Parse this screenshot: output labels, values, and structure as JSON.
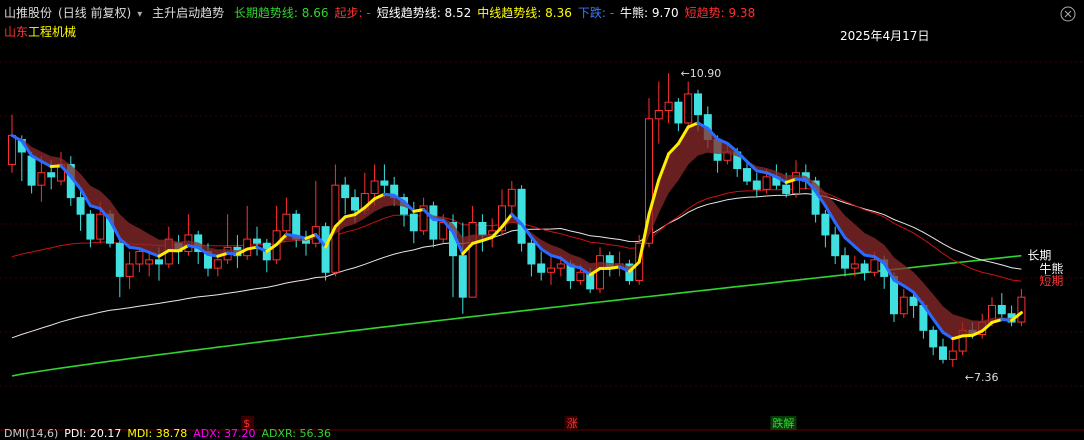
{
  "header": {
    "stock_name": "山推股份",
    "period": "(日线 前复权)",
    "dropdown_icon": "chevron-down-icon",
    "indicator_name": "主升启动趋势",
    "items": [
      {
        "label": "长期趋势线:",
        "value": "8.66",
        "color": "#2fd62f"
      },
      {
        "label": "起步:",
        "value": "-",
        "color": "#ff3030"
      },
      {
        "label": "短线趋势线:",
        "value": "8.52",
        "color": "#ffffff"
      },
      {
        "label": "中线趋势线:",
        "value": "8.36",
        "color": "#ffff00"
      },
      {
        "label": "下跌:",
        "value": "-",
        "color": "#3a7bff"
      },
      {
        "label": "牛熊:",
        "value": "9.70",
        "color": "#ffffff"
      },
      {
        "label": "短趋势:",
        "value": "9.38",
        "color": "#ff3030"
      }
    ],
    "close_icon": "close-circle-icon"
  },
  "subtitle": {
    "region": "山东",
    "sector": "工程机械"
  },
  "footer": {
    "items": [
      {
        "label": "DMI(14,6)",
        "value": "",
        "color": "#cccccc"
      },
      {
        "label": "PDI:",
        "value": "20.17",
        "color": "#ffffff"
      },
      {
        "label": "MDI:",
        "value": "38.78",
        "color": "#ffff00"
      },
      {
        "label": "ADX:",
        "value": "37.20",
        "color": "#ff00ff"
      },
      {
        "label": "ADXR:",
        "value": "56.36",
        "color": "#2fd62f"
      }
    ]
  },
  "chart_data": {
    "type": "candlestick",
    "ylim": [
      6.9,
      11.3
    ],
    "date_label": "2025年4月17日",
    "price_high": "10.90",
    "price_low": "7.36",
    "line_labels": {
      "bull_bear": "牛熊",
      "short_term": "短期",
      "long_term": "长期"
    },
    "signals": [
      {
        "index": 24,
        "text": "$",
        "color": "#ff3030"
      },
      {
        "index": 57,
        "text": "涨",
        "color": "#ff3030"
      },
      {
        "index": 78,
        "text": "跌解",
        "color": "#2fd62f"
      }
    ],
    "candles": [
      [
        9.8,
        10.15,
        10.4,
        9.7
      ],
      [
        10.1,
        9.95,
        10.15,
        9.6
      ],
      [
        9.9,
        9.55,
        9.95,
        9.45
      ],
      [
        9.55,
        9.7,
        9.9,
        9.35
      ],
      [
        9.7,
        9.65,
        9.85,
        9.5
      ],
      [
        9.6,
        9.8,
        9.95,
        9.55
      ],
      [
        9.8,
        9.4,
        9.9,
        9.3
      ],
      [
        9.4,
        9.2,
        9.5,
        9.0
      ],
      [
        9.2,
        8.9,
        9.25,
        8.8
      ],
      [
        8.9,
        9.2,
        9.35,
        8.85
      ],
      [
        9.2,
        8.85,
        9.25,
        8.8
      ],
      [
        8.85,
        8.45,
        8.9,
        8.2
      ],
      [
        8.45,
        8.6,
        8.75,
        8.3
      ],
      [
        8.6,
        8.75,
        8.8,
        8.5
      ],
      [
        8.6,
        8.65,
        8.75,
        8.45
      ],
      [
        8.65,
        8.6,
        8.8,
        8.4
      ],
      [
        8.6,
        8.9,
        9.05,
        8.55
      ],
      [
        8.85,
        8.75,
        8.95,
        8.6
      ],
      [
        8.75,
        8.95,
        9.2,
        8.7
      ],
      [
        8.95,
        8.75,
        9.0,
        8.6
      ],
      [
        8.75,
        8.55,
        8.85,
        8.45
      ],
      [
        8.55,
        8.65,
        8.7,
        8.45
      ],
      [
        8.65,
        8.8,
        9.2,
        8.6
      ],
      [
        8.8,
        8.7,
        8.95,
        8.55
      ],
      [
        8.7,
        8.9,
        9.3,
        8.65
      ],
      [
        8.9,
        8.85,
        9.05,
        8.7
      ],
      [
        8.85,
        8.65,
        8.9,
        8.5
      ],
      [
        8.65,
        9.0,
        9.3,
        8.6
      ],
      [
        9.0,
        9.2,
        9.4,
        8.9
      ],
      [
        9.2,
        8.9,
        9.25,
        8.8
      ],
      [
        8.9,
        8.85,
        9.0,
        8.7
      ],
      [
        8.85,
        9.05,
        9.6,
        8.8
      ],
      [
        9.05,
        8.5,
        9.1,
        8.4
      ],
      [
        8.5,
        9.55,
        9.8,
        8.45
      ],
      [
        9.55,
        9.4,
        9.65,
        9.2
      ],
      [
        9.4,
        9.25,
        9.5,
        9.1
      ],
      [
        9.25,
        9.45,
        9.7,
        9.2
      ],
      [
        9.45,
        9.6,
        9.8,
        9.3
      ],
      [
        9.6,
        9.55,
        9.8,
        9.4
      ],
      [
        9.55,
        9.4,
        9.65,
        9.3
      ],
      [
        9.4,
        9.2,
        9.45,
        9.05
      ],
      [
        9.2,
        9.0,
        9.35,
        8.85
      ],
      [
        9.0,
        9.3,
        9.4,
        8.95
      ],
      [
        9.3,
        8.9,
        9.35,
        8.8
      ],
      [
        8.9,
        9.1,
        9.2,
        8.85
      ],
      [
        9.1,
        8.7,
        9.2,
        8.2
      ],
      [
        8.7,
        8.2,
        9.1,
        8.0
      ],
      [
        8.2,
        9.1,
        9.3,
        8.2
      ],
      [
        9.1,
        8.95,
        9.2,
        8.75
      ],
      [
        8.95,
        9.0,
        9.15,
        8.8
      ],
      [
        9.0,
        9.3,
        9.5,
        8.95
      ],
      [
        9.3,
        9.5,
        9.6,
        9.2
      ],
      [
        9.5,
        8.85,
        9.55,
        8.75
      ],
      [
        8.85,
        8.6,
        8.9,
        8.45
      ],
      [
        8.6,
        8.5,
        8.75,
        8.4
      ],
      [
        8.5,
        8.55,
        8.7,
        8.35
      ],
      [
        8.55,
        8.6,
        8.7,
        8.45
      ],
      [
        8.6,
        8.4,
        8.65,
        8.3
      ],
      [
        8.4,
        8.5,
        8.6,
        8.35
      ],
      [
        8.5,
        8.3,
        8.55,
        8.25
      ],
      [
        8.3,
        8.7,
        8.8,
        8.25
      ],
      [
        8.7,
        8.55,
        8.75,
        8.45
      ],
      [
        8.55,
        8.6,
        8.75,
        8.45
      ],
      [
        8.6,
        8.4,
        8.65,
        8.35
      ],
      [
        8.4,
        8.85,
        8.95,
        8.35
      ],
      [
        8.85,
        10.35,
        10.6,
        8.8
      ],
      [
        10.35,
        10.45,
        10.8,
        10.05
      ],
      [
        10.45,
        10.55,
        10.9,
        10.3
      ],
      [
        10.55,
        10.3,
        10.6,
        10.2
      ],
      [
        10.3,
        10.65,
        10.8,
        10.25
      ],
      [
        10.65,
        10.4,
        10.7,
        10.2
      ],
      [
        10.4,
        10.1,
        10.5,
        10.0
      ],
      [
        10.1,
        9.85,
        10.15,
        9.7
      ],
      [
        9.85,
        9.95,
        10.05,
        9.8
      ],
      [
        9.95,
        9.75,
        10.0,
        9.65
      ],
      [
        9.75,
        9.6,
        9.85,
        9.55
      ],
      [
        9.6,
        9.5,
        9.7,
        9.4
      ],
      [
        9.5,
        9.65,
        9.75,
        9.45
      ],
      [
        9.65,
        9.55,
        9.8,
        9.5
      ],
      [
        9.55,
        9.45,
        9.7,
        9.4
      ],
      [
        9.45,
        9.7,
        9.85,
        9.4
      ],
      [
        9.7,
        9.6,
        9.8,
        9.5
      ],
      [
        9.6,
        9.2,
        9.65,
        9.1
      ],
      [
        9.2,
        8.95,
        9.25,
        8.8
      ],
      [
        8.95,
        8.7,
        9.05,
        8.6
      ],
      [
        8.7,
        8.55,
        8.8,
        8.45
      ],
      [
        8.55,
        8.6,
        8.7,
        8.45
      ],
      [
        8.6,
        8.5,
        8.65,
        8.4
      ],
      [
        8.5,
        8.65,
        8.75,
        8.45
      ],
      [
        8.65,
        8.45,
        8.7,
        8.3
      ],
      [
        8.45,
        8.0,
        8.5,
        7.9
      ],
      [
        8.0,
        8.2,
        8.3,
        7.95
      ],
      [
        8.2,
        8.1,
        8.25,
        7.95
      ],
      [
        8.1,
        7.8,
        8.15,
        7.7
      ],
      [
        7.8,
        7.6,
        7.85,
        7.5
      ],
      [
        7.6,
        7.45,
        7.7,
        7.4
      ],
      [
        7.45,
        7.55,
        7.7,
        7.36
      ],
      [
        7.55,
        7.8,
        7.9,
        7.5
      ],
      [
        7.8,
        7.75,
        7.9,
        7.7
      ],
      [
        7.75,
        7.9,
        8.0,
        7.7
      ],
      [
        7.9,
        8.1,
        8.2,
        7.85
      ],
      [
        8.1,
        8.0,
        8.25,
        7.95
      ],
      [
        8.0,
        7.9,
        8.1,
        7.85
      ],
      [
        7.9,
        8.2,
        8.3,
        7.85
      ]
    ]
  }
}
